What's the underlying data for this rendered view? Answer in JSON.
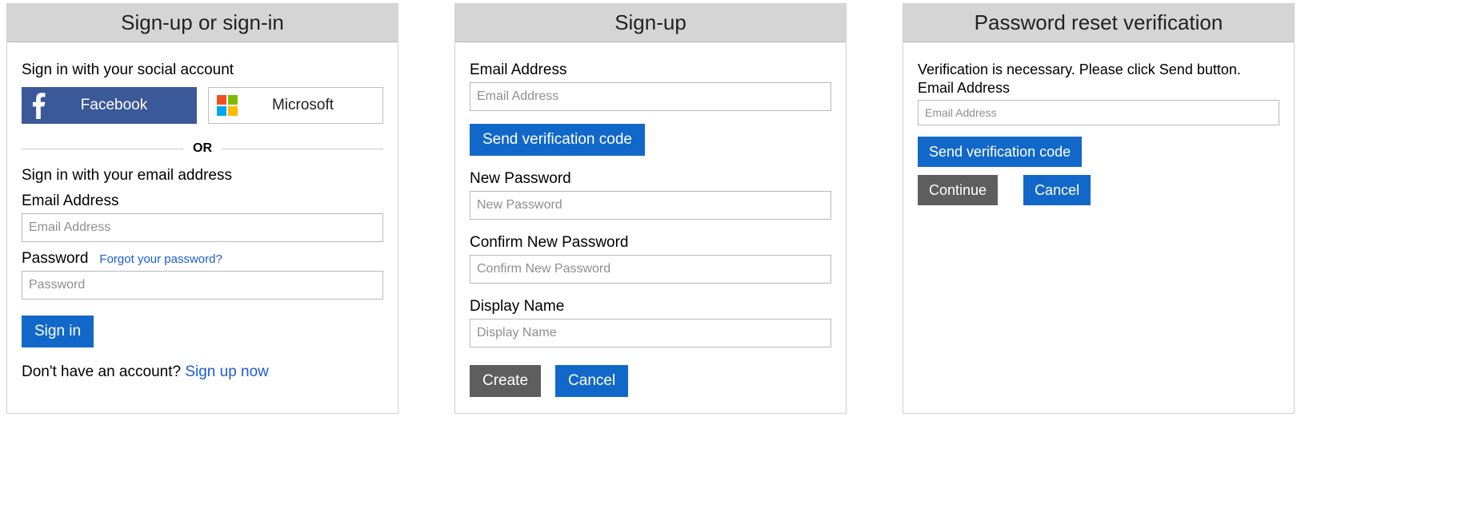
{
  "panel1": {
    "title": "Sign-up or sign-in",
    "social_label": "Sign in with your social account",
    "facebook_label": "Facebook",
    "microsoft_label": "Microsoft",
    "or_text": "OR",
    "email_section_label": "Sign in with your email address",
    "email_label": "Email Address",
    "email_placeholder": "Email Address",
    "password_label": "Password",
    "password_placeholder": "Password",
    "forgot_text": "Forgot your password?",
    "signin_label": "Sign in",
    "no_account_text": "Don't have an account? ",
    "signup_link_text": "Sign up now"
  },
  "panel2": {
    "title": "Sign-up",
    "email_label": "Email Address",
    "email_placeholder": "Email Address",
    "send_code_label": "Send verification code",
    "newpwd_label": "New Password",
    "newpwd_placeholder": "New Password",
    "confirm_label": "Confirm New Password",
    "confirm_placeholder": "Confirm New Password",
    "display_label": "Display Name",
    "display_placeholder": "Display Name",
    "create_label": "Create",
    "cancel_label": "Cancel"
  },
  "panel3": {
    "title": "Password reset verification",
    "instruction": "Verification is necessary. Please click Send button.",
    "email_label": "Email Address",
    "email_placeholder": "Email Address",
    "send_code_label": "Send verification code",
    "continue_label": "Continue",
    "cancel_label": "Cancel"
  }
}
